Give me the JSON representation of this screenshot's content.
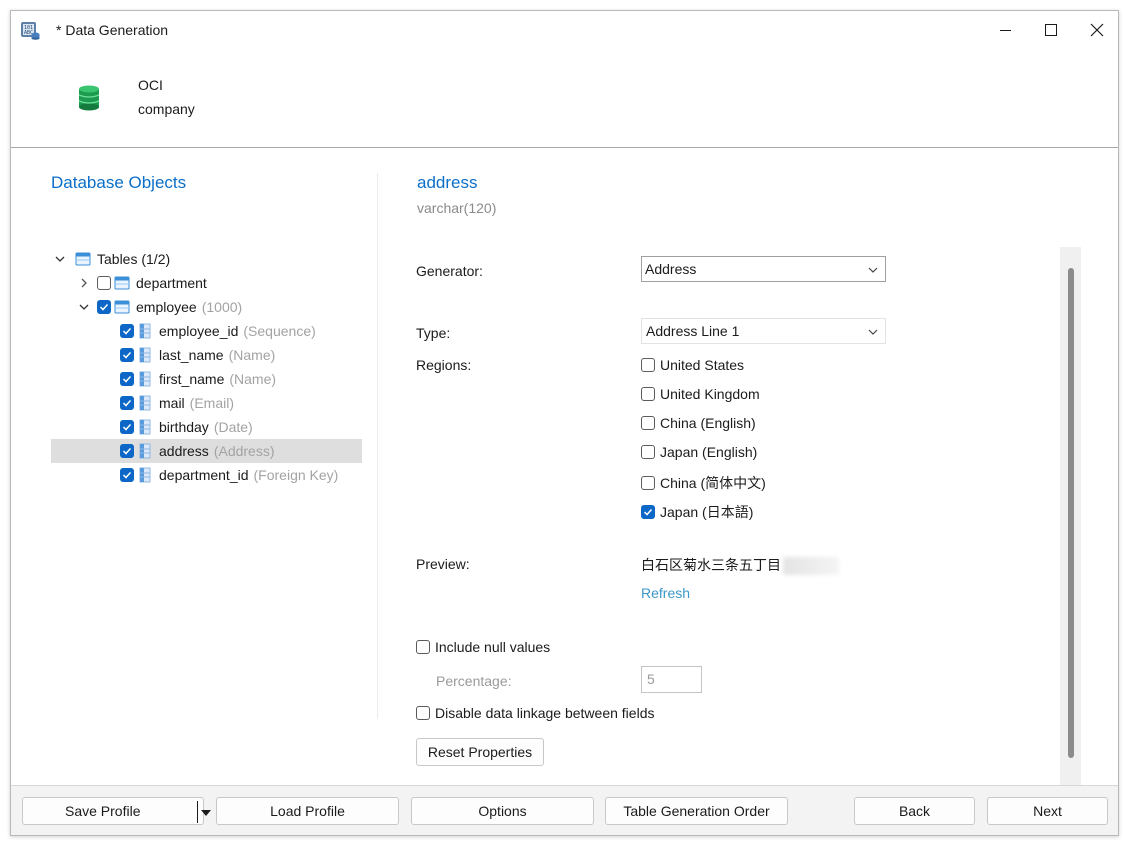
{
  "window": {
    "title": "* Data Generation",
    "controls": {
      "minimize": "minimize",
      "maximize": "maximize",
      "close": "close"
    }
  },
  "connection": {
    "name": "OCI",
    "database": "company",
    "icon": "database-icon",
    "icon_color": "#1c9b4f"
  },
  "left_panel": {
    "title": "Database Objects",
    "tree": {
      "root_label": "Tables (1/2)",
      "tables": [
        {
          "name": "department",
          "count": "",
          "checked": false,
          "expanded": false
        },
        {
          "name": "employee",
          "count": "(1000)",
          "checked": true,
          "expanded": true
        }
      ],
      "fields": [
        {
          "name": "employee_id",
          "generator": "(Sequence)",
          "checked": true,
          "selected": false
        },
        {
          "name": "last_name",
          "generator": "(Name)",
          "checked": true,
          "selected": false
        },
        {
          "name": "first_name",
          "generator": "(Name)",
          "checked": true,
          "selected": false
        },
        {
          "name": "mail",
          "generator": "(Email)",
          "checked": true,
          "selected": false
        },
        {
          "name": "birthday",
          "generator": "(Date)",
          "checked": true,
          "selected": false
        },
        {
          "name": "address",
          "generator": "(Address)",
          "checked": true,
          "selected": true
        },
        {
          "name": "department_id",
          "generator": "(Foreign Key)",
          "checked": true,
          "selected": false
        }
      ]
    }
  },
  "right_panel": {
    "column_name": "address",
    "column_type": "varchar(120)",
    "generator_label": "Generator:",
    "generator_value": "Address",
    "type_label": "Type:",
    "type_value": "Address Line 1",
    "regions_label": "Regions:",
    "regions": [
      {
        "label": "United States",
        "checked": false
      },
      {
        "label": "United Kingdom",
        "checked": false
      },
      {
        "label": "China (English)",
        "checked": false
      },
      {
        "label": "Japan (English)",
        "checked": false
      },
      {
        "label": "China (简体中文)",
        "checked": false
      },
      {
        "label": "Japan (日本語)",
        "checked": true
      }
    ],
    "preview_label": "Preview:",
    "preview_value": "白石区菊水三条五丁目",
    "refresh_label": "Refresh",
    "include_null_label": "Include null values",
    "include_null_checked": false,
    "percentage_label": "Percentage:",
    "percentage_value": "5",
    "disable_linkage_label": "Disable data linkage between fields",
    "disable_linkage_checked": false,
    "reset_label": "Reset Properties"
  },
  "footer": {
    "save_profile": "Save Profile",
    "load_profile": "Load Profile",
    "options": "Options",
    "table_generation_order": "Table Generation Order",
    "back": "Back",
    "next": "Next"
  },
  "colors": {
    "accent": "#0b6fc9",
    "checkbox_checked": "#0c67c7",
    "link": "#3b98c9",
    "muted_text": "#a3a3a3",
    "selected_row": "#dedede"
  }
}
